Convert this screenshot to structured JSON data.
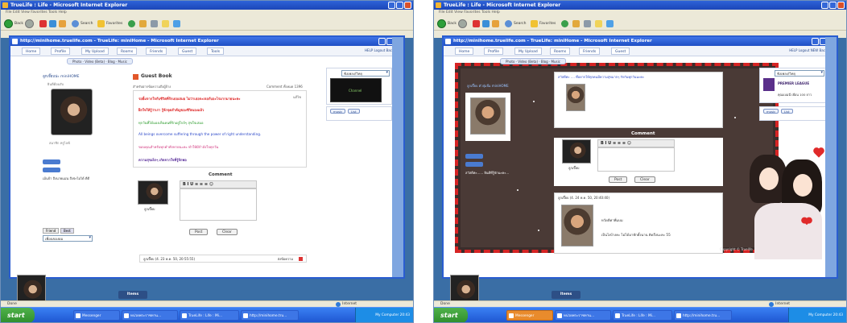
{
  "left": {
    "window_title": "TrueLife : Life - Microsoft Internet Explorer",
    "menu": "File   Edit   View   Favorites   Tools   Help",
    "toolbar": {
      "back": "Back",
      "search": "Search",
      "favorites": "Favorites"
    },
    "inner_title": "http://minihome.truelife.com - TrueLife: miniHome - Microsoft Internet Explorer",
    "nav_tabs": [
      "Home",
      "Profile",
      "My Upload",
      "Rooms",
      "Friends",
      "Guest",
      "Tools"
    ],
    "nav_right": "HELP   Logout   Back out",
    "subnav": "Photo  ·  Video (Beta)  ·  Blog  ·  Music",
    "profile_name": "ลูกเจี๊ยบน่ะ miniHOME",
    "profile_sub": "ยินดีต้อนรับ",
    "guestbook_title": "Guest Book",
    "guestbook_sub": "สำหรับฝากข้อความถึงผู้จ้าง",
    "comment_count": "Comment ทั้งหมด 1396",
    "reply_label": "แก้ไข",
    "lines": [
      "รอยิ้มจากใจกับชีวิตที่รักเธอเสมอ ไม่ว่าเธอจะเจอกับอะไรมากมายนะคะ",
      "ฝึกใจให้รู้ว่าเรา รู้จักจุดสำคัญของชีวิตเองแล้ว",
      "ทุกวันที่ได้มองเห็นคนที่รักอยู่ใกล้ๆ สุขใจเสมอ",
      "All beings overcome suffering through the power of right understanding.",
      "ขอบคุณสำหรับทุกคำทักทายนะคะ ทำให้มีกำลังใจทุกวัน",
      "ความสุขเล็กๆ เกิดจากใจที่รู้จักพอ"
    ],
    "comment_title": "Comment",
    "editor_toolbar": "B  I  U  ≡ ≡ ≡  ☺",
    "post_btn": "Post",
    "clear_btn": "Clear",
    "avatar_caption": "ลูกเจี๊ยบ",
    "left_meta": "สมาชิก   ทรูไลฟ์",
    "left_note": "เม้นจ้า ถึงนายแม่น ถึงจ่ะไม่ได้ ดีดี",
    "friend_tab": "Friend",
    "best_tab": "Best",
    "dropdown": "เพื่อนของผม",
    "radio_panel": "ฟังเพลง/วิทยุ",
    "channel": "Channel",
    "music_btn": "music",
    "list_btn": "List",
    "entry_meta": "ลูกเจี๊ยบ (4. 23 พ.ค. 50, 20:55:55)",
    "entry_action": "ส่งข้อความ",
    "status_done": "Done",
    "status_zone": "Internet",
    "items_btn": "Items",
    "start": "start",
    "tasks": [
      "Messenger",
      "หน่วยพระราชทาน...",
      "TrueLife : Life : Mi...",
      "http://minihome.tru..."
    ],
    "tray": "My Computer  20:43"
  },
  "right": {
    "window_title": "TrueLife : Life - Microsoft Internet Explorer",
    "menu": "File   Edit   View   Favorites   Tools   Help",
    "toolbar": {
      "back": "Back",
      "search": "Search",
      "favorites": "Favorites"
    },
    "inner_title": "http://minihome.truelife.com - TrueLife: miniHome - Microsoft Internet Explorer",
    "nav_tabs": [
      "Home",
      "Profile",
      "My Upload",
      "Rooms",
      "Friends",
      "Guest"
    ],
    "nav_right": "HELP   Logout   NEW   Back out",
    "subnav": "Photo  ·  Video (Beta)  ·  Blog  ·  Music",
    "profile_name": "ลูกเจี๊ยบ ตัวจุ๋มจิ๋ม miniHOME",
    "post_text": "สวัสดีค่ะ  .... ที่อยากให้ทุกคนมีความสุขมากๆ รักกันทุกวันนะคะ",
    "comment_title": "Comment",
    "editor_toolbar": "B  I  U  ≡ ≡ ≡  ☺",
    "post_btn": "Post",
    "clear_btn": "Clear",
    "avatar_caption": "ลูกเจี๊ยบ",
    "left_note": "สวัสดีค่ะ...... ยินดีที่รู้จักนะคะ...",
    "entry_meta": "ลูกเจี๊ยบ (4. 24 พ.ค. 50, 20:40:40)",
    "entry_text_1": "หวัดดีค่าพี่แบม",
    "entry_text_2": "เป็นไงบ้างคะ ไม่ได้มาทักตั้งนาน คิดถึงนะคะ 55",
    "radio_panel": "ฟังเพลง/วิทยุ",
    "league": "PREMIER LEAGUE",
    "league_sub": "คุณแบมนี่ เพื่อน 100 ยาว",
    "music_btn": "music",
    "list_btn": "List",
    "footer": "Copyright © Truelife",
    "status_done": "Done",
    "status_zone": "Internet",
    "items_btn": "Items",
    "start": "start",
    "tasks": [
      "Messenger",
      "หน่วยพระราชทาน...",
      "TrueLife : Life : Mi...",
      "http://minihome.tru..."
    ],
    "tray": "My Computer  20:43"
  }
}
